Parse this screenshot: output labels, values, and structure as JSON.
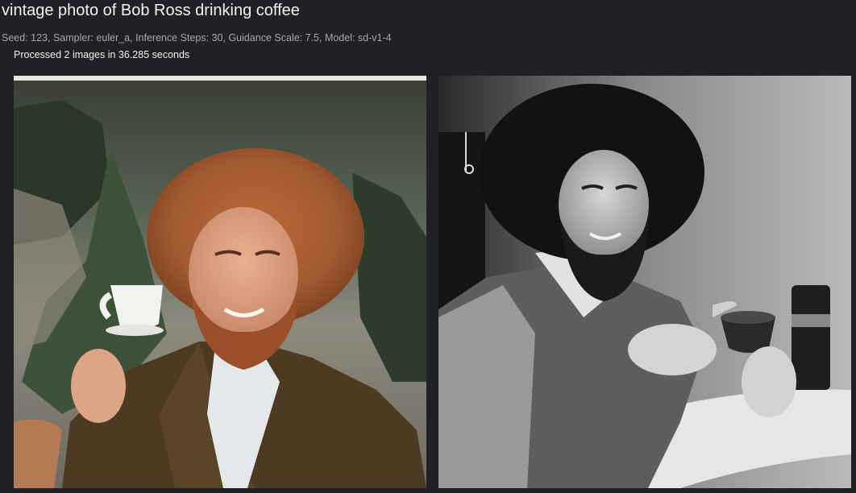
{
  "task": {
    "prompt": "vintage photo of Bob Ross drinking coffee",
    "settings_line": "Seed: 123, Sampler: euler_a, Inference Steps: 30, Guidance Scale: 7.5, Model: sd-v1-4",
    "status": "Processed 2 images in 36.285 seconds"
  },
  "images": [
    {
      "style": "color"
    },
    {
      "style": "black-and-white"
    }
  ]
}
